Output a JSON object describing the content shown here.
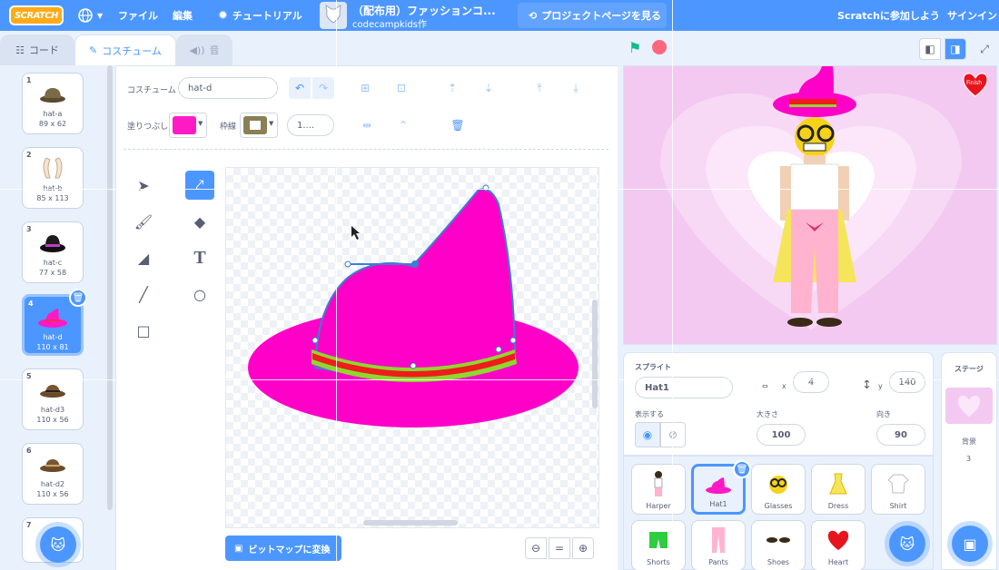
{
  "menubar": {
    "logo": "SCRATCH",
    "language_icon": "globe-icon",
    "file": "ファイル",
    "edit": "編集",
    "tutorials": "チュートリアル",
    "project_title": "（配布用）ファッションコ...",
    "project_author": "codecampkids作",
    "see_project_page": "プロジェクトページを見る",
    "join": "Scratchに参加しよう",
    "signin": "サインイン"
  },
  "tabs": {
    "code": "コード",
    "costumes": "コスチューム",
    "sounds": "音"
  },
  "costumes": [
    {
      "num": "1",
      "name": "hat-a",
      "size": "89 x 62",
      "icon": "brown-hat-icon"
    },
    {
      "num": "2",
      "name": "hat-b",
      "size": "85 x 113",
      "icon": "white-hat-icon"
    },
    {
      "num": "3",
      "name": "hat-c",
      "size": "77 x 58",
      "icon": "black-hat-icon"
    },
    {
      "num": "4",
      "name": "hat-d",
      "size": "110 x 81",
      "icon": "pink-hat-icon"
    },
    {
      "num": "5",
      "name": "hat-d3",
      "size": "110 x 56",
      "icon": "brown-hat-icon"
    },
    {
      "num": "6",
      "name": "hat-d2",
      "size": "110 x 56",
      "icon": "brown-hat-icon"
    },
    {
      "num": "7",
      "name": "",
      "size": "",
      "icon": ""
    }
  ],
  "paint": {
    "costume_label": "コスチューム",
    "costume_name": "hat-d",
    "fill_label": "塗りつぶし",
    "fill_color": "#ff1ac6",
    "outline_label": "枠線",
    "outline_color": "#8a7f55",
    "outline_width": "1....",
    "convert_button": "ビットマップに変換"
  },
  "sprite": {
    "label": "スプライト",
    "name": "Hat1",
    "x_label": "x",
    "x": "4",
    "y_label": "y",
    "y": "140",
    "show_label": "表示する",
    "size_label": "大きさ",
    "size": "100",
    "direction_label": "向き",
    "direction": "90"
  },
  "sprites": [
    {
      "name": "Harper",
      "icon": "harper-icon"
    },
    {
      "name": "Hat1",
      "icon": "pink-hat-icon"
    },
    {
      "name": "Glasses",
      "icon": "glasses-icon"
    },
    {
      "name": "Dress",
      "icon": "dress-icon"
    },
    {
      "name": "Shirt",
      "icon": "shirt-icon"
    },
    {
      "name": "Shorts",
      "icon": "shorts-icon"
    },
    {
      "name": "Pants",
      "icon": "pants-icon"
    },
    {
      "name": "Shoes",
      "icon": "shoes-icon"
    },
    {
      "name": "Heart",
      "icon": "heart-icon"
    }
  ],
  "stage_panel": {
    "label": "ステージ",
    "backdrop_label": "背景",
    "backdrop_count": "3"
  },
  "stage": {
    "finish_label": "Finish"
  }
}
